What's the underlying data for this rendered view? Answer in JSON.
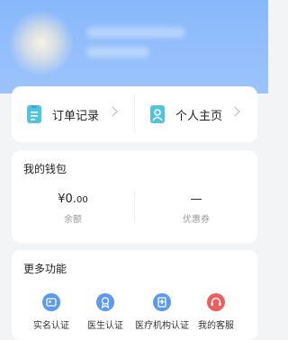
{
  "header": {
    "avatar": "avatar-blurred"
  },
  "quick_links": {
    "orders": {
      "label": "订单记录",
      "icon": "clipboard-icon"
    },
    "profile": {
      "label": "个人主页",
      "icon": "person-icon"
    }
  },
  "wallet": {
    "title": "我的钱包",
    "balance": {
      "value_main": "¥0.",
      "value_cents": "00",
      "label": "余额"
    },
    "coupons": {
      "value": "—",
      "label": "优惠券"
    }
  },
  "more": {
    "title": "更多功能",
    "items": [
      {
        "label": "实名认证",
        "icon": "id-card-icon",
        "color": "#5b9af0"
      },
      {
        "label": "医生认证",
        "icon": "badge-icon",
        "color": "#5b9af0"
      },
      {
        "label": "医疗机构认证",
        "icon": "hospital-icon",
        "color": "#5b9af0"
      },
      {
        "label": "我的客服",
        "icon": "headset-icon",
        "color": "#ec5f5f"
      }
    ]
  },
  "colors": {
    "header": "#8fbcfb",
    "accent_icon": "#4fc3e0",
    "background": "#f3f4f6"
  }
}
